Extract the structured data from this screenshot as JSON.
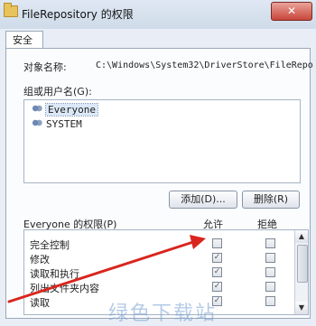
{
  "window": {
    "title": "FileRepository 的权限",
    "close_label": "✕"
  },
  "tabs": [
    {
      "label": "安全"
    }
  ],
  "object": {
    "label": "对象名称:",
    "value": "C:\\Windows\\System32\\DriverStore\\FileRepo"
  },
  "groups": {
    "label": "组或用户名(G):",
    "users": [
      {
        "name": "Everyone",
        "selected": true
      },
      {
        "name": "SYSTEM",
        "selected": false
      }
    ],
    "add_label": "添加(D)...",
    "remove_label": "删除(R)"
  },
  "permissions": {
    "label": "Everyone 的权限(P)",
    "allow_header": "允许",
    "deny_header": "拒绝",
    "rows": [
      {
        "name": "完全控制",
        "allow": false,
        "deny": false
      },
      {
        "name": "修改",
        "allow": true,
        "deny": false
      },
      {
        "name": "读取和执行",
        "allow": true,
        "deny": false
      },
      {
        "name": "列出文件夹内容",
        "allow": true,
        "deny": false
      },
      {
        "name": "读取",
        "allow": true,
        "deny": false
      }
    ]
  },
  "watermark": "绿色下载站",
  "annotation_color": "#d8261e"
}
